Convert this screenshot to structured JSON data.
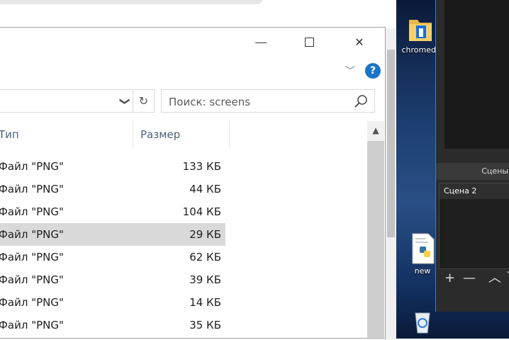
{
  "desktop": {
    "icons": [
      {
        "label": "chromedr",
        "icon": "folder-icon"
      },
      {
        "label": "new",
        "icon": "python-file-icon"
      },
      {
        "label": "",
        "icon": "recycle-bin-icon"
      }
    ]
  },
  "obs": {
    "scenes_header": "Сцены",
    "scene_item": "Сцена 2",
    "tools": {
      "add": "+",
      "remove": "—",
      "up": "︿",
      "down": "﹀"
    }
  },
  "explorer": {
    "window_controls": {
      "minimize_icon": "minimize-icon",
      "maximize_icon": "maximize-icon",
      "close": "✕"
    },
    "ribbon_toggle": "﹀",
    "help": "?",
    "address": {
      "dropdown": "❯",
      "refresh": "↻"
    },
    "search": {
      "placeholder": "Поиск: screens"
    },
    "columns": {
      "type": "Тип",
      "size": "Размер"
    },
    "files": [
      {
        "type": "Файл \"PNG\"",
        "size": "133 КБ",
        "selected": false
      },
      {
        "type": "Файл \"PNG\"",
        "size": "44 КБ",
        "selected": false
      },
      {
        "type": "Файл \"PNG\"",
        "size": "104 КБ",
        "selected": false
      },
      {
        "type": "Файл \"PNG\"",
        "size": "29 КБ",
        "selected": true
      },
      {
        "type": "Файл \"PNG\"",
        "size": "62 КБ",
        "selected": false
      },
      {
        "type": "Файл \"PNG\"",
        "size": "39 КБ",
        "selected": false
      },
      {
        "type": "Файл \"PNG\"",
        "size": "14 КБ",
        "selected": false
      },
      {
        "type": "Файл \"PNG\"",
        "size": "35 КБ",
        "selected": false
      }
    ],
    "scroll_up": "▲"
  }
}
